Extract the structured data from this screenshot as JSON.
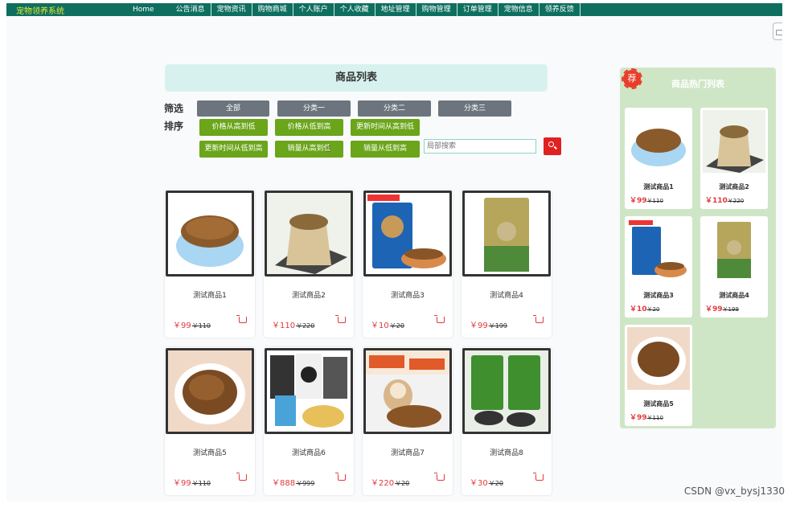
{
  "nav": {
    "brand": "宠物领养系统",
    "links": [
      "Home",
      "公告消息",
      "宠物资讯",
      "购物商城",
      "个人账户",
      "个人收藏",
      "地址管理",
      "购物管理",
      "订单管理",
      "宠物信息",
      "领养反馈"
    ]
  },
  "product_list": {
    "title": "商品列表",
    "filter_label": "筛选",
    "sort_label": "排序",
    "filters": [
      "全部",
      "分类一",
      "分类二",
      "分类三"
    ],
    "sorts": [
      "价格从高到低",
      "价格从低到高",
      "更新时间从高到低",
      "更新时间从低到高",
      "销量从高到低",
      "销量从低到高"
    ],
    "search_placeholder": "局部搜索",
    "products": [
      {
        "name": "测试商品1",
        "price": "￥99",
        "old_price": "￥110",
        "image": "cat-food-blue-bowl"
      },
      {
        "name": "测试商品2",
        "price": "￥110",
        "old_price": "￥220",
        "image": "cat-food-burlap-sack"
      },
      {
        "name": "测试商品3",
        "price": "￥10",
        "old_price": "￥20",
        "image": "cat-food-blue-bag"
      },
      {
        "name": "测试商品4",
        "price": "￥99",
        "old_price": "￥199",
        "image": "fresh-cat-food-bag"
      },
      {
        "name": "测试商品5",
        "price": "￥99",
        "old_price": "￥110",
        "image": "cat-food-plate"
      },
      {
        "name": "测试商品6",
        "price": "￥888",
        "old_price": "￥999",
        "image": "dog-food-bags"
      },
      {
        "name": "测试商品7",
        "price": "￥220",
        "old_price": "￥20",
        "image": "dog-food-poster"
      },
      {
        "name": "测试商品8",
        "price": "￥30",
        "old_price": "￥20",
        "image": "green-food-bags"
      }
    ]
  },
  "hot_list": {
    "stamp": "荐",
    "title": "商品热门列表",
    "products": [
      {
        "name": "测试商品1",
        "price": "￥99",
        "old_price": "￥110",
        "image": "cat-food-blue-bowl"
      },
      {
        "name": "测试商品2",
        "price": "￥110",
        "old_price": "￥220",
        "image": "cat-food-burlap-sack"
      },
      {
        "name": "测试商品3",
        "price": "￥10",
        "old_price": "￥20",
        "image": "cat-food-blue-bag"
      },
      {
        "name": "测试商品4",
        "price": "￥99",
        "old_price": "￥199",
        "image": "fresh-cat-food-bag"
      },
      {
        "name": "测试商品5",
        "price": "￥99",
        "old_price": "￥110",
        "image": "cat-food-plate"
      }
    ]
  },
  "watermark": "CSDN @vx_bysj1330",
  "colors": {
    "nav_bg": "#0e6f60",
    "brand": "#e5e835",
    "filter_button": "#6c757d",
    "sort_button": "#6aa51a",
    "price": "#e4393c",
    "title_bg": "#d7f2ee",
    "hot_bg": "#cfe6c6",
    "search_button": "#e12020"
  }
}
